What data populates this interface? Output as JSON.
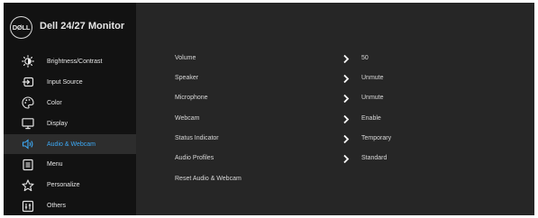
{
  "header": {
    "logo_text": "DØLL",
    "title": "Dell 24/27 Monitor"
  },
  "sidebar": {
    "items": [
      {
        "label": "Brightness/Contrast",
        "icon": "brightness-icon"
      },
      {
        "label": "Input Source",
        "icon": "input-source-icon"
      },
      {
        "label": "Color",
        "icon": "palette-icon"
      },
      {
        "label": "Display",
        "icon": "display-icon"
      },
      {
        "label": "Audio & Webcam",
        "icon": "audio-icon",
        "active": true
      },
      {
        "label": "Menu",
        "icon": "menu-icon"
      },
      {
        "label": "Personalize",
        "icon": "star-icon"
      },
      {
        "label": "Others",
        "icon": "others-icon"
      }
    ]
  },
  "settings": {
    "rows": [
      {
        "label": "Volume",
        "value": "50"
      },
      {
        "label": "Speaker",
        "value": "Unmute"
      },
      {
        "label": "Microphone",
        "value": "Unmute"
      },
      {
        "label": "Webcam",
        "value": "Enable"
      },
      {
        "label": "Status Indicator",
        "value": "Temporary"
      },
      {
        "label": "Audio Profiles",
        "value": "Standard"
      },
      {
        "label": "Reset Audio & Webcam",
        "value": ""
      }
    ]
  },
  "colors": {
    "accent": "#3da9f5",
    "panel": "#262626",
    "sidebar": "#121212",
    "text": "#e6e6e6"
  }
}
